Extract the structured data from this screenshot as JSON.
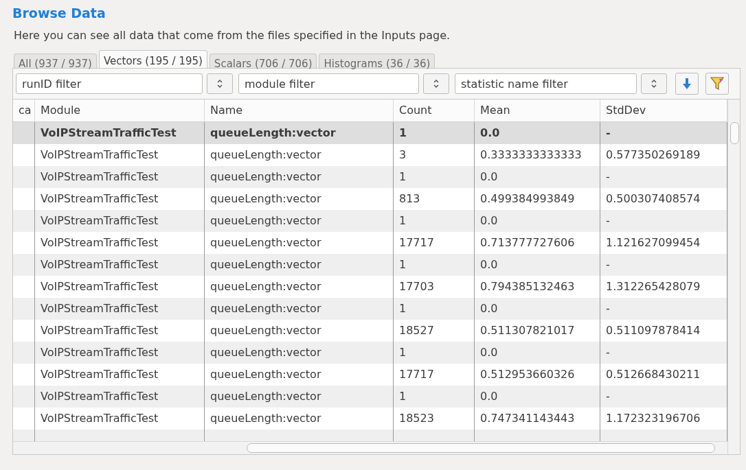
{
  "title": "Browse Data",
  "description": "Here you can see all data that come from the files specified in the Inputs page.",
  "tabs": [
    {
      "label": "All (937 / 937)",
      "selected": false
    },
    {
      "label": "Vectors (195 / 195)",
      "selected": true
    },
    {
      "label": "Scalars (706 / 706)",
      "selected": false
    },
    {
      "label": "Histograms (36 / 36)",
      "selected": false
    }
  ],
  "filters": [
    {
      "placeholder": "runID filter"
    },
    {
      "placeholder": "module filter"
    },
    {
      "placeholder": "statistic name filter"
    }
  ],
  "table": {
    "columns": [
      "ca",
      "Module",
      "Name",
      "Count",
      "Mean",
      "StdDev"
    ],
    "rows": [
      {
        "selected": true,
        "cells": [
          "",
          "VoIPStreamTrafficTest",
          "queueLength:vector",
          "1",
          "0.0",
          "-"
        ]
      },
      {
        "selected": false,
        "cells": [
          "",
          "VoIPStreamTrafficTest",
          "queueLength:vector",
          "3",
          "0.3333333333333",
          "0.577350269189"
        ]
      },
      {
        "selected": false,
        "cells": [
          "",
          "VoIPStreamTrafficTest",
          "queueLength:vector",
          "1",
          "0.0",
          "-"
        ]
      },
      {
        "selected": false,
        "cells": [
          "",
          "VoIPStreamTrafficTest",
          "queueLength:vector",
          "813",
          "0.499384993849",
          "0.500307408574"
        ]
      },
      {
        "selected": false,
        "cells": [
          "",
          "VoIPStreamTrafficTest",
          "queueLength:vector",
          "1",
          "0.0",
          "-"
        ]
      },
      {
        "selected": false,
        "cells": [
          "",
          "VoIPStreamTrafficTest",
          "queueLength:vector",
          "17717",
          "0.713777727606",
          "1.121627099454"
        ]
      },
      {
        "selected": false,
        "cells": [
          "",
          "VoIPStreamTrafficTest",
          "queueLength:vector",
          "1",
          "0.0",
          "-"
        ]
      },
      {
        "selected": false,
        "cells": [
          "",
          "VoIPStreamTrafficTest",
          "queueLength:vector",
          "17703",
          "0.794385132463",
          "1.312265428079"
        ]
      },
      {
        "selected": false,
        "cells": [
          "",
          "VoIPStreamTrafficTest",
          "queueLength:vector",
          "1",
          "0.0",
          "-"
        ]
      },
      {
        "selected": false,
        "cells": [
          "",
          "VoIPStreamTrafficTest",
          "queueLength:vector",
          "18527",
          "0.511307821017",
          "0.511097878414"
        ]
      },
      {
        "selected": false,
        "cells": [
          "",
          "VoIPStreamTrafficTest",
          "queueLength:vector",
          "1",
          "0.0",
          "-"
        ]
      },
      {
        "selected": false,
        "cells": [
          "",
          "VoIPStreamTrafficTest",
          "queueLength:vector",
          "17717",
          "0.512953660326",
          "0.512668430211"
        ]
      },
      {
        "selected": false,
        "cells": [
          "",
          "VoIPStreamTrafficTest",
          "queueLength:vector",
          "1",
          "0.0",
          "-"
        ]
      },
      {
        "selected": false,
        "cells": [
          "",
          "VoIPStreamTrafficTest",
          "queueLength:vector",
          "18523",
          "0.747341143443",
          "1.172323196706"
        ]
      }
    ]
  }
}
